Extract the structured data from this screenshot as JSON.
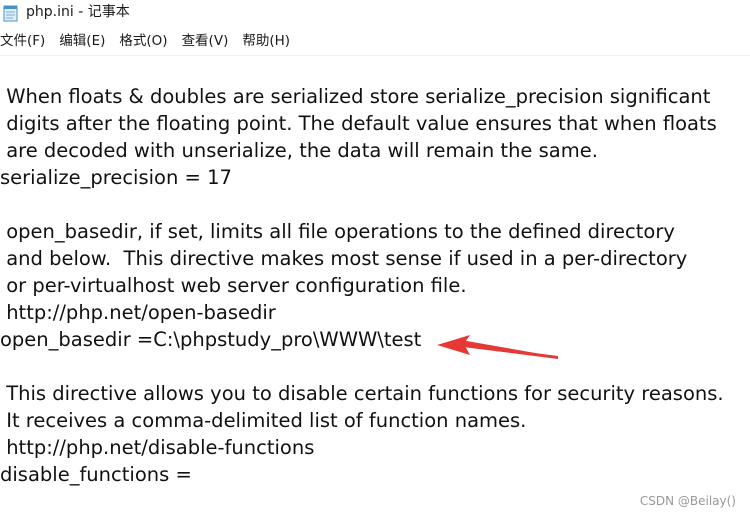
{
  "window": {
    "title": "php.ini - 记事本",
    "app_icon": "notepad-icon"
  },
  "menu": {
    "items": [
      {
        "label": "文件(F)"
      },
      {
        "label": "编辑(E)"
      },
      {
        "label": "格式(O)"
      },
      {
        "label": "查看(V)"
      },
      {
        "label": "帮助(H)"
      }
    ]
  },
  "editor": {
    "lines": [
      " When floats & doubles are serialized store serialize_precision significant",
      " digits after the floating point. The default value ensures that when floats",
      " are decoded with unserialize, the data will remain the same.",
      "serialize_precision = 17",
      "",
      " open_basedir, if set, limits all file operations to the defined directory",
      " and below.  This directive makes most sense if used in a per-directory",
      " or per-virtualhost web server configuration file.",
      " http://php.net/open-basedir",
      "open_basedir =C:\\phpstudy_pro\\WWW\\test",
      "",
      " This directive allows you to disable certain functions for security reasons.",
      " It receives a comma-delimited list of function names.",
      " http://php.net/disable-functions",
      "disable_functions ="
    ]
  },
  "annotation": {
    "arrow_icon": "red-arrow-icon",
    "arrow_color": "#e53935"
  },
  "watermark": {
    "text": "CSDN @Beilay()"
  }
}
